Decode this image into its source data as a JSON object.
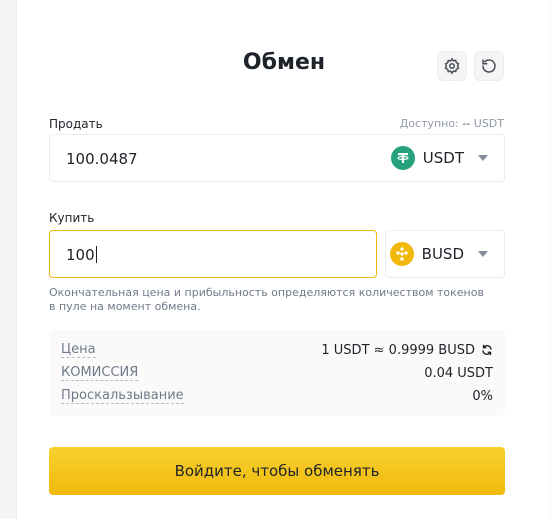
{
  "title": "Обмен",
  "icons": {
    "settings": "gear-icon",
    "history": "history-icon",
    "refresh": "refresh-icon"
  },
  "sell": {
    "label": "Продать",
    "available_label": "Доступно:",
    "available_value": "--",
    "available_unit": "USDT",
    "amount": "100.0487",
    "token": "USDT",
    "token_color": "#26a17b"
  },
  "buy": {
    "label": "Купить",
    "amount": "100",
    "token": "BUSD",
    "token_color": "#f0b90b"
  },
  "note": "Окончательная цена и прибыльность определяются количеством токенов в пуле на момент обмена.",
  "info": {
    "price_label": "Цена",
    "price_value": "1 USDT ≈ 0.9999 BUSD",
    "fee_label": "КОМИССИЯ",
    "fee_value": "0.04 USDT",
    "slippage_label": "Проскальзывание",
    "slippage_value": "0%"
  },
  "login_button": "Войдите, чтобы обменять",
  "colors": {
    "accent": "#f0b90b",
    "text": "#1e2329",
    "muted": "#707a8a"
  }
}
